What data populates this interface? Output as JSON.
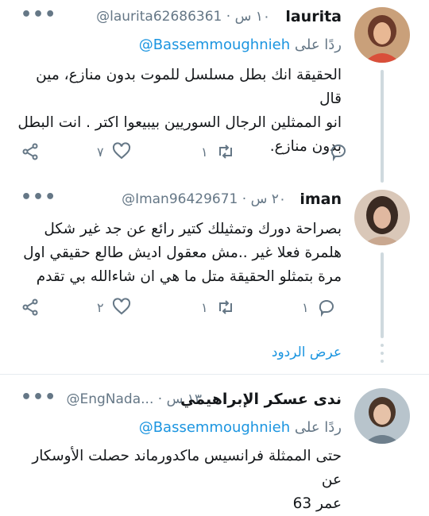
{
  "tweets": [
    {
      "display_name": "laurita",
      "handle": "@laurita62686361",
      "time": "١٠ س",
      "replying_prefix": "ردًا على",
      "replying_handle": "@Bassemmoughnieh",
      "lines": [
        "الحقيقة انك بطل مسلسل للموت بدون منازع، مين قال",
        "انو الممثلين الرجال السوريين بيبيعوا اكتر . انت البطل",
        "بدون منازع."
      ],
      "likes": "٧",
      "retweets": "١",
      "replies": "",
      "avatar_colors": {
        "bg": "#c9a07a",
        "face": "#e8b894",
        "hair": "#6b3a2a",
        "top": "#d94f3a"
      }
    },
    {
      "display_name": "iman",
      "handle": "@Iman96429671",
      "time": "٢٠ س",
      "replying_prefix": "",
      "replying_handle": "",
      "lines": [
        "بصراحة دورك وتمثيلك كتير رائع عن جد غير شكل",
        "هلمرة فعلا غير ..مش معقول اديش طالع حقيقي اول",
        "مرة بتمثلو الحقيقة متل ما هي    ان شاءالله بي تقدم"
      ],
      "likes": "٢",
      "retweets": "١",
      "replies": "١",
      "avatar_colors": {
        "bg": "#d9c7b8",
        "face": "#e0b8a0",
        "hair": "#3a2a22",
        "top": "#c9a890"
      }
    },
    {
      "display_name": "ندى عسكر الإبراهيمي",
      "handle": "@EngNada...",
      "time": "١٣ س",
      "replying_prefix": "ردًا على",
      "replying_handle": "@Bassemmoughnieh",
      "lines": [
        "حتى الممثلة فرانسيس ماكدورماند حصلت الأوسكار عن",
        "عمر 63"
      ],
      "likes": "",
      "retweets": "",
      "replies": "",
      "avatar_colors": {
        "bg": "#b8c4cc",
        "face": "#e6c2a8",
        "hair": "#4a3528",
        "top": "#6e7f8c"
      }
    }
  ],
  "show_replies_label": "عرض الردود",
  "more_glyph": "•••",
  "colors": {
    "link": "#1b95e0",
    "muted": "#657786",
    "line": "#cfd9de",
    "divider": "#e6ecf0"
  }
}
